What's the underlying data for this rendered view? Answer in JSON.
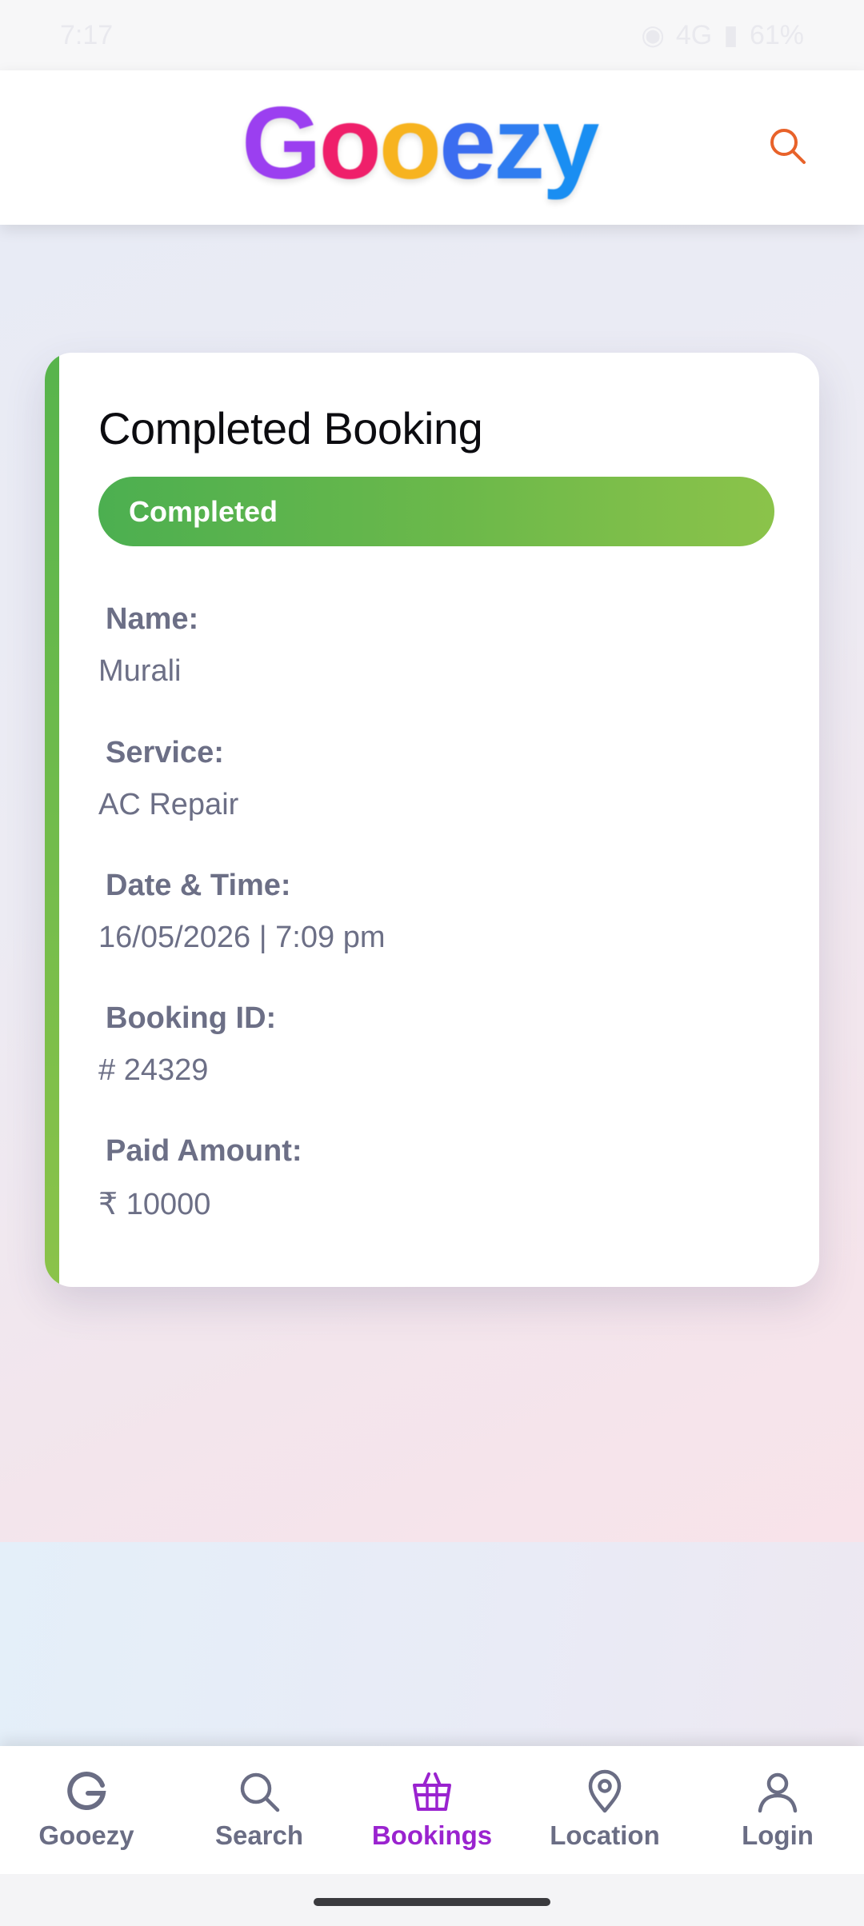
{
  "status_bar": {
    "time": "7:17",
    "network": "4G",
    "battery": "61%"
  },
  "header": {
    "logo_letters": [
      {
        "ch": "G",
        "color": "#9b3ff0"
      },
      {
        "ch": "o",
        "color": "#ef1f6a"
      },
      {
        "ch": "o",
        "color": "#f7b31f"
      },
      {
        "ch": "e",
        "color": "#3b6df0"
      },
      {
        "ch": "z",
        "color": "#2f7df0"
      },
      {
        "ch": "y",
        "color": "#1a8ef2"
      }
    ],
    "search_icon": "search-icon",
    "accent_color": "#e8622a"
  },
  "booking": {
    "title": "Completed Booking",
    "status": "Completed",
    "status_color": "#4caf50",
    "fields": [
      {
        "label": "Name:",
        "value": "Murali"
      },
      {
        "label": "Service:",
        "value": "AC Repair"
      },
      {
        "label": "Date & Time:",
        "value": "16/05/2026 | 7:09 pm"
      },
      {
        "label": "Booking ID:",
        "value": "# 24329"
      },
      {
        "label": "Paid Amount:",
        "value": "₹ 10000"
      }
    ]
  },
  "bottom_nav": {
    "items": [
      {
        "label": "Gooezy",
        "icon": "g-logo-icon"
      },
      {
        "label": "Search",
        "icon": "search-icon"
      },
      {
        "label": "Bookings",
        "icon": "basket-icon",
        "active": true
      },
      {
        "label": "Location",
        "icon": "location-pin-icon"
      },
      {
        "label": "Login",
        "icon": "user-icon"
      }
    ],
    "active_color": "#9a23cf"
  }
}
